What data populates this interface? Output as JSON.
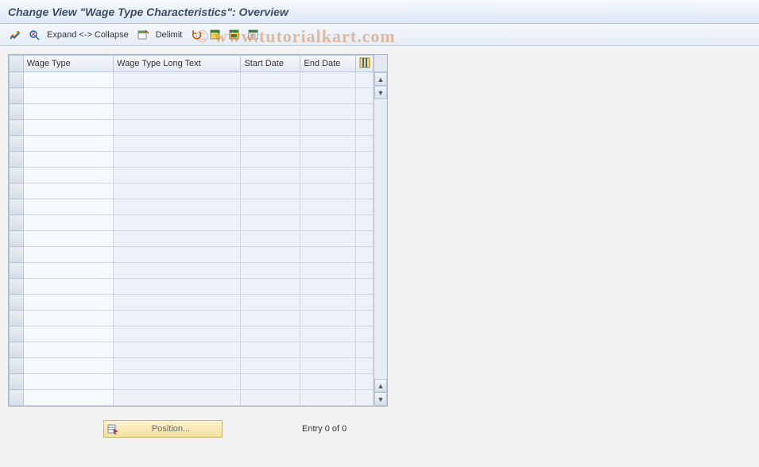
{
  "title": "Change View \"Wage Type Characteristics\": Overview",
  "toolbar": {
    "expand_collapse_label": "Expand <-> Collapse",
    "delimit_label": "Delimit"
  },
  "table": {
    "columns": {
      "wage_type": "Wage Type",
      "wage_type_long": "Wage Type Long Text",
      "start_date": "Start Date",
      "end_date": "End Date"
    },
    "row_count": 21
  },
  "footer": {
    "position_label": "Position...",
    "entry_label": "Entry 0 of 0"
  },
  "watermark": "© www.tutorialkart.com"
}
